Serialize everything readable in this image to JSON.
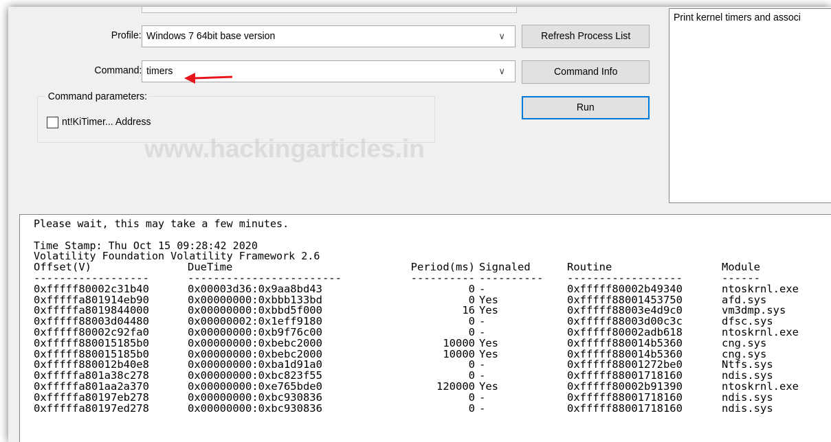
{
  "watermark": "www.hackingarticles.in",
  "form": {
    "profile_label": "Profile:",
    "profile_value": "Windows 7 64bit base version",
    "command_label": "Command:",
    "command_value": "timers",
    "params_group_title": "Command parameters:",
    "param_checkbox_label": "nt!KiTimer... Address",
    "param_checkbox_checked": false
  },
  "buttons": {
    "refresh": "Refresh Process List",
    "command_info": "Command Info",
    "run": "Run"
  },
  "info_box": {
    "text": "Print kernel timers and associ"
  },
  "output": {
    "wait_message": "Please wait, this may take a few minutes.",
    "timestamp": "Time Stamp: Thu Oct 15 09:28:42 2020",
    "framework": "Volatility Foundation Volatility Framework 2.6",
    "headers": [
      "Offset(V)",
      "DueTime",
      "Period(ms)",
      "Signaled",
      "Routine",
      "Module"
    ],
    "separators": [
      "------------------",
      "------------------------",
      "----------",
      "----------",
      "------------------",
      "------"
    ],
    "rows": [
      [
        "0xfffff80002c31b40",
        "0x00003d36:0x9aa8bd43",
        "0",
        "-",
        "0xfffff80002b49340",
        "ntoskrnl.exe"
      ],
      [
        "0xfffffa801914eb90",
        "0x00000000:0xbbb133bd",
        "0",
        "Yes",
        "0xfffff88001453750",
        "afd.sys"
      ],
      [
        "0xfffffa8019844000",
        "0x00000000:0xbbd5f000",
        "16",
        "Yes",
        "0xfffff88003e4d9c0",
        "vm3dmp.sys"
      ],
      [
        "0xfffff88003d04480",
        "0x00000002:0x1eff9180",
        "0",
        "-",
        "0xfffff88003d00c3c",
        "dfsc.sys"
      ],
      [
        "0xfffff80002c92fa0",
        "0x00000000:0xb9f76c00",
        "0",
        "-",
        "0xfffff80002adb618",
        "ntoskrnl.exe"
      ],
      [
        "0xfffff880015185b0",
        "0x00000000:0xbebc2000",
        "10000",
        "Yes",
        "0xfffff880014b5360",
        "cng.sys"
      ],
      [
        "0xfffff880015185b0",
        "0x00000000:0xbebc2000",
        "10000",
        "Yes",
        "0xfffff880014b5360",
        "cng.sys"
      ],
      [
        "0xfffff880012b40e8",
        "0x00000000:0xba1d91a0",
        "0",
        "-",
        "0xfffff88001272be0",
        "Ntfs.sys"
      ],
      [
        "0xfffffa801a38c278",
        "0x00000000:0xbc823f55",
        "0",
        "-",
        "0xfffff88001718160",
        "ndis.sys"
      ],
      [
        "0xfffffa801aa2a370",
        "0x00000000:0xe765bde0",
        "120000",
        "Yes",
        "0xfffff80002b91390",
        "ntoskrnl.exe"
      ],
      [
        "0xfffffa80197eb278",
        "0x00000000:0xbc930836",
        "0",
        "-",
        "0xfffff88001718160",
        "ndis.sys"
      ],
      [
        "0xfffffa80197ed278",
        "0x00000000:0xbc930836",
        "0",
        "-",
        "0xfffff88001718160",
        "ndis.sys"
      ]
    ]
  },
  "colors": {
    "window_bg": "#f0f0f0",
    "default_button_border": "#0078d7",
    "arrow": "#e8141b"
  }
}
